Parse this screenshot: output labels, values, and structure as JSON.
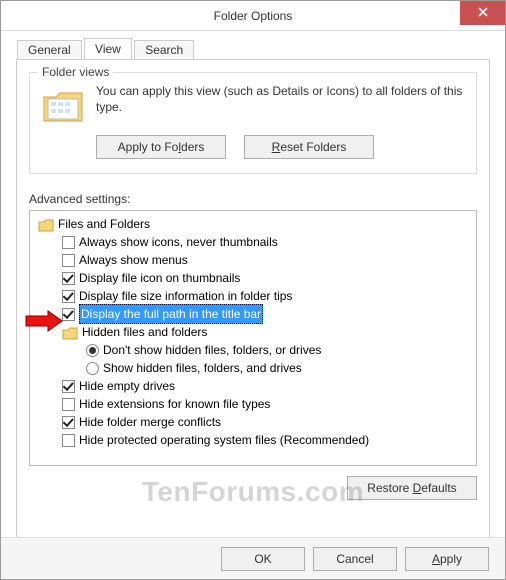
{
  "window": {
    "title": "Folder Options"
  },
  "tabs": {
    "general": "General",
    "view": "View",
    "search": "Search",
    "active": "view"
  },
  "folder_views": {
    "group_title": "Folder views",
    "text": "You can apply this view (such as Details or Icons) to all folders of this type.",
    "apply_btn": "Apply to Folders",
    "reset_btn": "Reset Folders"
  },
  "advanced": {
    "label": "Advanced settings:",
    "heading": "Files and Folders",
    "items": [
      {
        "type": "check",
        "checked": false,
        "label": "Always show icons, never thumbnails"
      },
      {
        "type": "check",
        "checked": false,
        "label": "Always show menus"
      },
      {
        "type": "check",
        "checked": true,
        "label": "Display file icon on thumbnails"
      },
      {
        "type": "check",
        "checked": true,
        "label": "Display file size information in folder tips"
      },
      {
        "type": "check",
        "checked": true,
        "label": "Display the full path in the title bar",
        "selected": true
      },
      {
        "type": "folder",
        "label": "Hidden files and folders"
      },
      {
        "type": "radio",
        "selected": true,
        "label": "Don't show hidden files, folders, or drives"
      },
      {
        "type": "radio",
        "selected": false,
        "label": "Show hidden files, folders, and drives"
      },
      {
        "type": "check",
        "checked": true,
        "label": "Hide empty drives"
      },
      {
        "type": "check",
        "checked": false,
        "label": "Hide extensions for known file types"
      },
      {
        "type": "check",
        "checked": true,
        "label": "Hide folder merge conflicts"
      },
      {
        "type": "check",
        "checked": false,
        "label": "Hide protected operating system files (Recommended)"
      }
    ],
    "restore_btn": "Restore Defaults"
  },
  "footer": {
    "ok": "OK",
    "cancel": "Cancel",
    "apply": "Apply"
  },
  "watermark": "TenForums.com"
}
